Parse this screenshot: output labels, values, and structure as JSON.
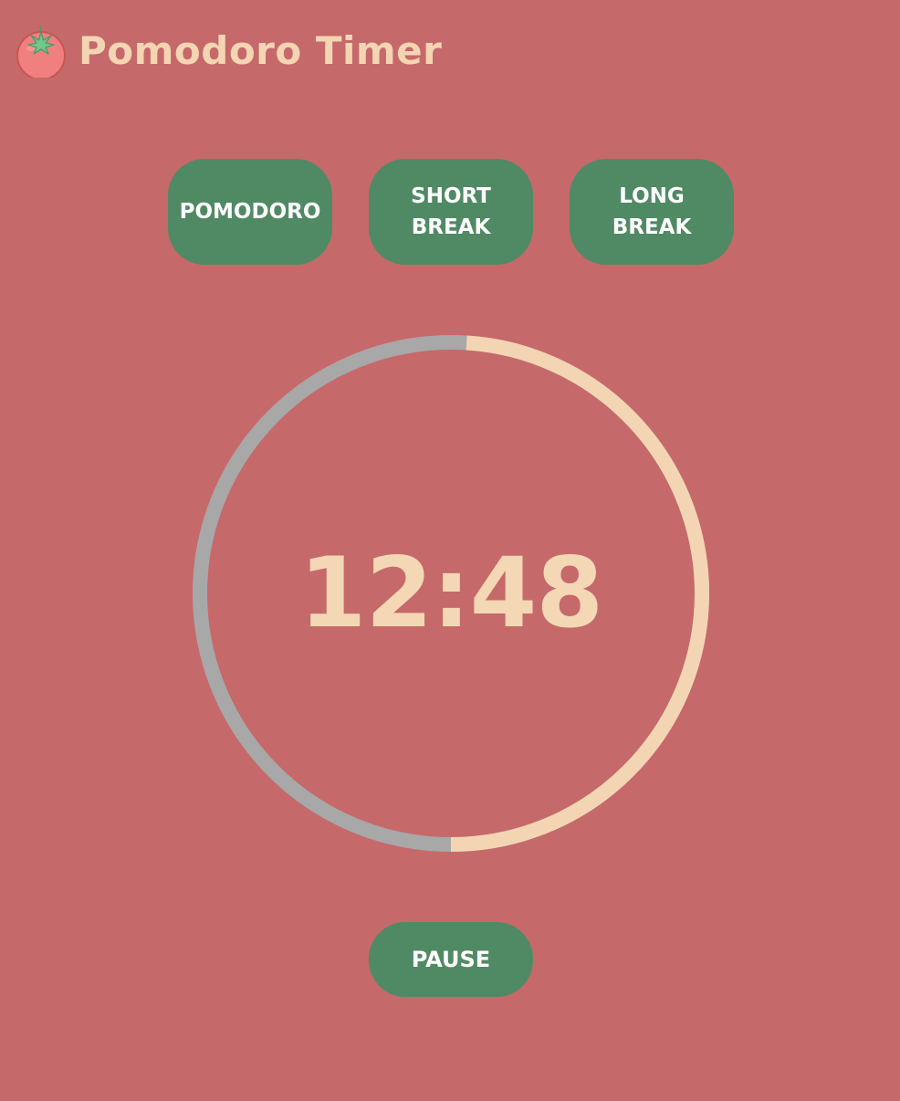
{
  "app": {
    "title": "Pomodoro Timer",
    "logo_icon": "tomato-icon"
  },
  "modes": [
    {
      "label": "POMODORO"
    },
    {
      "label": "SHORT BREAK"
    },
    {
      "label": "LONG BREAK"
    }
  ],
  "timer": {
    "display": "12:48",
    "progress_elapsed": 0.49
  },
  "controls": {
    "pause_label": "PAUSE"
  },
  "colors": {
    "background": "#c6696a",
    "button": "#508a64",
    "button_text": "#ffffff",
    "accent": "#f4d5b3",
    "ring_track": "#a8a8a8"
  }
}
